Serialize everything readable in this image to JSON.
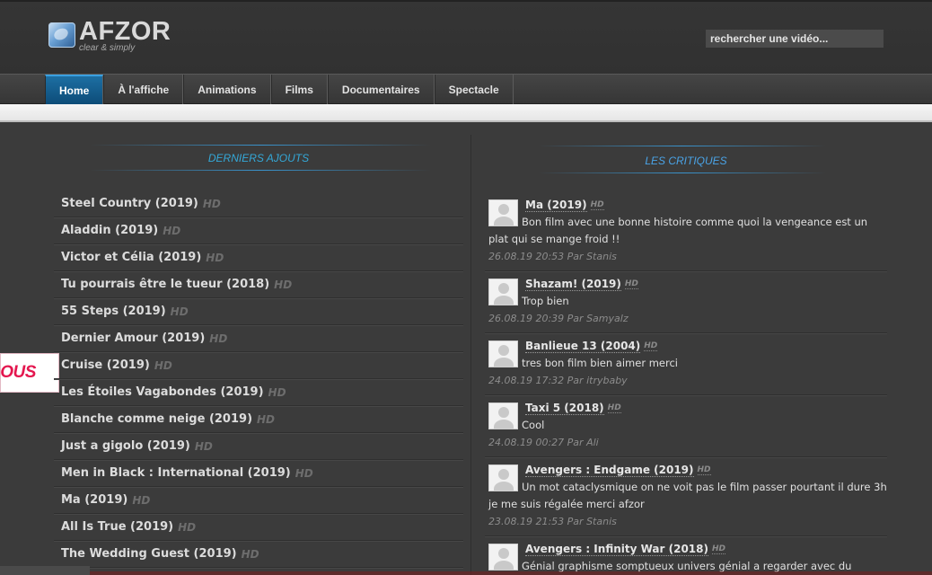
{
  "header": {
    "logo_text": "AFZOR",
    "logo_tagline": "clear & simply",
    "search_value": "rechercher une vidéo..."
  },
  "nav": {
    "items": [
      {
        "label": "Home",
        "active": true
      },
      {
        "label": "À l'affiche",
        "active": false
      },
      {
        "label": "Animations",
        "active": false
      },
      {
        "label": "Films",
        "active": false
      },
      {
        "label": "Documentaires",
        "active": false
      },
      {
        "label": "Spectacle",
        "active": false
      }
    ]
  },
  "latest": {
    "title": "DERNIERS AJOUTS",
    "items": [
      {
        "title": "Steel Country (2019)",
        "badge": "HD"
      },
      {
        "title": "Aladdin (2019)",
        "badge": "HD"
      },
      {
        "title": "Victor et Célia (2019)",
        "badge": "HD"
      },
      {
        "title": "Tu pourrais être le tueur (2018)",
        "badge": "HD"
      },
      {
        "title": "55 Steps (2019)",
        "badge": "HD"
      },
      {
        "title": "Dernier Amour (2019)",
        "badge": "HD"
      },
      {
        "title": "Cruise (2019)",
        "badge": "HD"
      },
      {
        "title": "Les Étoiles Vagabondes (2019)",
        "badge": "HD"
      },
      {
        "title": "Blanche comme neige (2019)",
        "badge": "HD"
      },
      {
        "title": "Just a gigolo (2019)",
        "badge": "HD"
      },
      {
        "title": "Men in Black : International (2019)",
        "badge": "HD"
      },
      {
        "title": "Ma (2019)",
        "badge": "HD"
      },
      {
        "title": "All Is True (2019)",
        "badge": "HD"
      },
      {
        "title": "The Wedding Guest (2019)",
        "badge": "HD"
      }
    ]
  },
  "reviews": {
    "title": "LES CRITIQUES",
    "items": [
      {
        "title": "Ma (2019)",
        "badge": "HD",
        "text": "Bon film avec une bonne histoire comme quoi la vengeance est un plat qui se mange froid !!",
        "meta": "26.08.19 20:53 Par Stanis"
      },
      {
        "title": "Shazam! (2019)",
        "badge": "HD",
        "text": "Trop bien",
        "meta": "26.08.19 20:39 Par Samyalz"
      },
      {
        "title": "Banlieue 13 (2004)",
        "badge": "HD",
        "text": "tres bon film bien aimer merci",
        "meta": "24.08.19 17:32 Par itrybaby"
      },
      {
        "title": "Taxi 5 (2018)",
        "badge": "HD",
        "text": "Cool",
        "meta": "24.08.19 00:27 Par Ali"
      },
      {
        "title": "Avengers : Endgame (2019)",
        "badge": "HD",
        "text": "Un mot cataclysmique on ne voit pas le film passer pourtant il dure 3h je me suis régalée merci afzor",
        "meta": "23.08.19 21:53 Par Stanis"
      },
      {
        "title": "Avengers : Infinity War (2018)",
        "badge": "HD",
        "text": "Génial graphisme somptueux univers génial a regarder avec du popcorn",
        "meta": ""
      }
    ]
  },
  "promo": {
    "text": "NOUS"
  }
}
